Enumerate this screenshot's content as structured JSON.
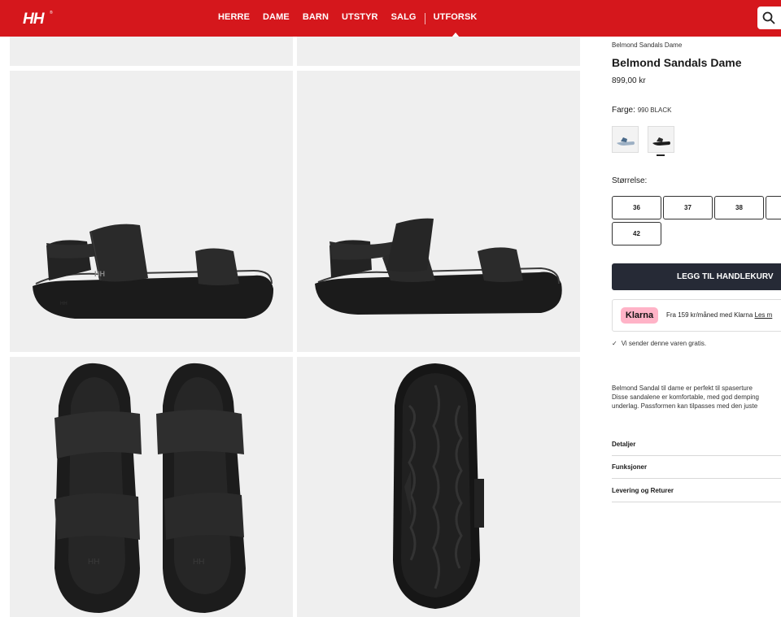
{
  "header": {
    "brand": "HH",
    "nav": [
      "HERRE",
      "DAME",
      "BARN",
      "UTSTYR",
      "SALG",
      "UTFORSK"
    ],
    "active_nav": "UTFORSK"
  },
  "product": {
    "breadcrumb": "Belmond Sandals Dame",
    "title": "Belmond Sandals Dame",
    "price": "899,00 kr",
    "color_label": "Farge:",
    "color_value": "990 BLACK",
    "size_label": "Størrelse:",
    "sizes": [
      "36",
      "37",
      "38",
      "",
      "42"
    ],
    "add_to_cart": "LEGG TIL HANDLEKURV",
    "klarna": {
      "badge": "Klarna",
      "text": "Fra 159 kr/måned med Klarna ",
      "link": "Les m"
    },
    "shipping": "Vi sender denne varen gratis.",
    "description": [
      "Belmond Sandal til dame er perfekt til spaserture",
      "Disse sandalene er komfortable, med god demping",
      "underlag. Passformen kan tilpasses med den juste"
    ],
    "accordion": [
      "Detaljer",
      "Funksjoner",
      "Levering og Returer"
    ]
  },
  "colors": {
    "brand_red": "#d5171c",
    "cart_button": "#262a36",
    "klarna_pink": "#ffb3c7",
    "tile_bg": "#efefef"
  }
}
